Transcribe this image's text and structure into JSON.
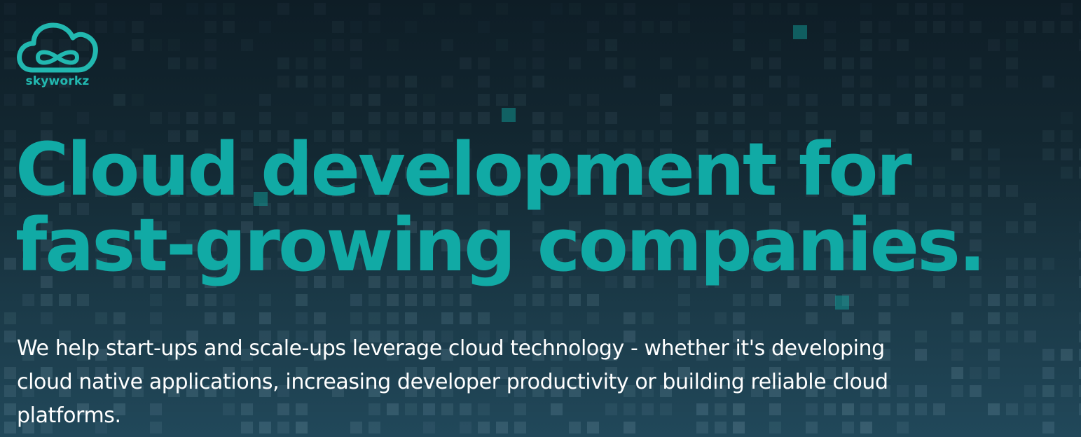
{
  "brand": {
    "name": "skyworkz",
    "logo_icon": "cloud-infinity-icon",
    "accent_color": "#22b8b0"
  },
  "hero": {
    "headline_line1": "Cloud development for",
    "headline_line2": "fast-growing companies.",
    "headline_color": "#11aaa5",
    "subheadline": "We help start-ups and scale-ups leverage cloud technology - whether it's developing cloud native applications, increasing developer productivity or building reliable cloud platforms.",
    "background_colors": [
      "#0e1d26",
      "#21485a"
    ]
  }
}
